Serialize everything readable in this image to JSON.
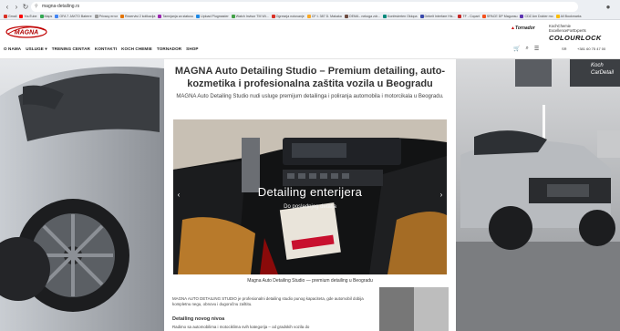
{
  "browser": {
    "url": "magna-detailing.rs",
    "bookmarks": [
      {
        "label": "Gmail",
        "color": "#d93025"
      },
      {
        "label": "YouTube",
        "color": "#ff0000"
      },
      {
        "label": "Maps",
        "color": "#34a853"
      },
      {
        "label": "OFA 7 JAKTO Baterre",
        "color": "#4285f4"
      },
      {
        "label": "Privacy error",
        "color": "#999999"
      },
      {
        "label": "Rezervisi 2 kolikacija",
        "color": "#e37400"
      },
      {
        "label": "Tamnjanja za statusu",
        "color": "#9c27b0"
      },
      {
        "label": "Upload Plugmaster",
        "color": "#1e88e5"
      },
      {
        "label": "Watch Invisor TM Wi...",
        "color": "#43a047"
      },
      {
        "label": "Ogreseja notovanje",
        "color": "#d93025"
      },
      {
        "label": "CF t. 387 D. Makaka",
        "color": "#f9a825"
      },
      {
        "label": "OEMA - nekoga zdr...",
        "color": "#6d4c41"
      },
      {
        "label": "Konfesierten Oklopa",
        "color": "#00897b"
      },
      {
        "label": "Debelt Interfare His...",
        "color": "#3949ab"
      },
      {
        "label": "TF - Copart",
        "color": "#c62828"
      },
      {
        "label": "SPACE DP Magunsu",
        "color": "#f4511e"
      },
      {
        "label": "CDZ Am Dokter mo",
        "color": "#5e35b1"
      },
      {
        "label": "All Bookmarks",
        "color": "#fbbc04"
      }
    ]
  },
  "header": {
    "logo": "MAGNA",
    "nav": [
      "O NAMA",
      "USLUGE ▾",
      "TRENING CENTAR",
      "KONTAKTI",
      "KOCH CHEMIE",
      "TORNADOR",
      "SHOP"
    ],
    "tornador": "Tornador",
    "koch_line1": "KochChemie",
    "koch_line2": "ExcellenceForExperts",
    "colourlock": "COLOURLOCK",
    "lang": "SR",
    "phone": "+381 60 75 47 00"
  },
  "content": {
    "title": "MAGNA Auto Detailing Studio – Premium detailing, auto-kozmetika i profesionalna zaštita vozila u Beogradu",
    "lead": "MAGNA Auto Detailing Studio nudi usluge premijum detailinga i poliranja automobila i motorcikala u Beogradu.",
    "slide_title": "Detailing enterijera",
    "slide_sub": "Do poslednjeg detalja",
    "caption": "Magna Auto Detailing Studio — premium detailing u Beogradu",
    "para1": "MAGNA AUTO DETAILING STUDIO je profesionalni detailing studio punog kapaciteta, gde automobil dobija kompletnu negu, obnovu i dugoročnu zaštitu.",
    "h3": "Detailing novog nivoa",
    "para2": "Radimo sa automobilima i motociklima svih kategorija – od gradskih vozila do"
  },
  "colors": {
    "accent": "#c00000",
    "background": "#2b2b2b"
  }
}
